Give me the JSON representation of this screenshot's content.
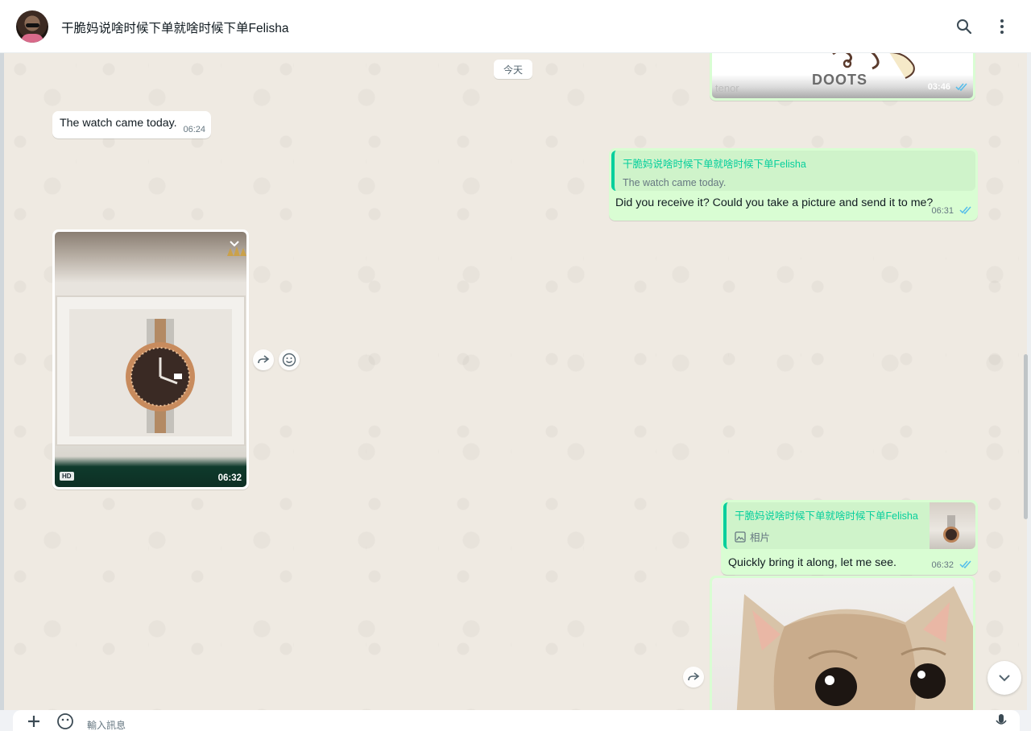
{
  "header": {
    "title": "干脆妈说啥时候下单就啥时候下单Felisha",
    "icons": [
      "search-icon",
      "more-vert-icon"
    ]
  },
  "chat": {
    "date_chip": "今天",
    "messages": [
      {
        "id": "gif-top",
        "direction": "out",
        "type": "gif",
        "gif_text": "DOOTS",
        "source_label": "tenor",
        "time": "03:46",
        "status": "read"
      },
      {
        "id": "msg-watch-came",
        "direction": "in",
        "type": "text",
        "text": "The watch came today.",
        "time": "06:24"
      },
      {
        "id": "msg-receive",
        "direction": "out",
        "type": "text",
        "quote": {
          "name": "干脆妈说啥时候下单就啥时候下单Felisha",
          "text": "The watch came today."
        },
        "text": "Did you receive it? Could you take a picture and send it to me?",
        "time": "06:31",
        "status": "read"
      },
      {
        "id": "msg-watch-photo",
        "direction": "in",
        "type": "image",
        "badge": "HD",
        "time": "06:32"
      },
      {
        "id": "msg-bring",
        "direction": "out",
        "type": "text",
        "quote": {
          "name": "干脆妈说啥时候下单就啥时候下单Felisha",
          "text": "相片"
        },
        "text": "Quickly bring it along, let me see.",
        "time": "06:32",
        "status": "read"
      },
      {
        "id": "msg-cat",
        "direction": "out",
        "type": "image"
      }
    ]
  },
  "composer": {
    "placeholder": "輸入訊息"
  },
  "colors": {
    "outgoing_bubble": "#d9fdd3",
    "incoming_bubble": "#ffffff",
    "quote_accent": "#06cf9c",
    "read_ticks": "#53bdeb",
    "wallpaper": "#efeae2"
  }
}
